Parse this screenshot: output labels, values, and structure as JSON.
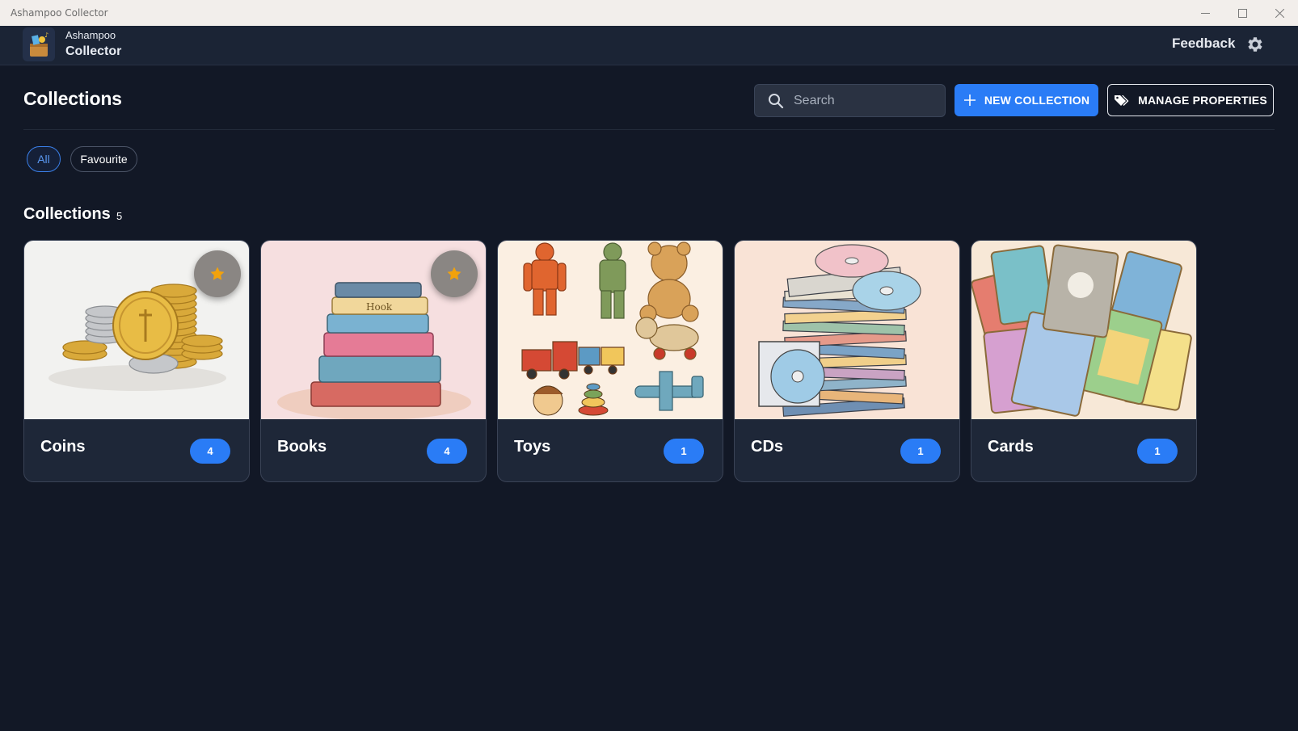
{
  "window": {
    "title": "Ashampoo Collector",
    "controls": [
      "minimize-icon",
      "maximize-icon",
      "close-icon"
    ]
  },
  "app": {
    "brand_small": "Ashampoo",
    "brand_big": "Collector",
    "feedback_label": "Feedback",
    "settings_icon": "gear-icon"
  },
  "header": {
    "title": "Collections",
    "search_placeholder": "Search",
    "new_collection_label": "NEW COLLECTION",
    "manage_properties_label": "MANAGE PROPERTIES"
  },
  "filters": {
    "items": [
      {
        "label": "All",
        "active": true
      },
      {
        "label": "Favourite",
        "active": false
      }
    ]
  },
  "section": {
    "title": "Collections",
    "count": "5"
  },
  "collections": [
    {
      "name": "Coins",
      "count": "4",
      "favourite": true
    },
    {
      "name": "Books",
      "count": "4",
      "favourite": true
    },
    {
      "name": "Toys",
      "count": "1",
      "favourite": false
    },
    {
      "name": "CDs",
      "count": "1",
      "favourite": false
    },
    {
      "name": "Cards",
      "count": "1",
      "favourite": false
    }
  ],
  "colors": {
    "background": "#121826",
    "accent": "#2a7cf6",
    "card": "#1e2738",
    "favourite_star": "#f2a20c"
  }
}
